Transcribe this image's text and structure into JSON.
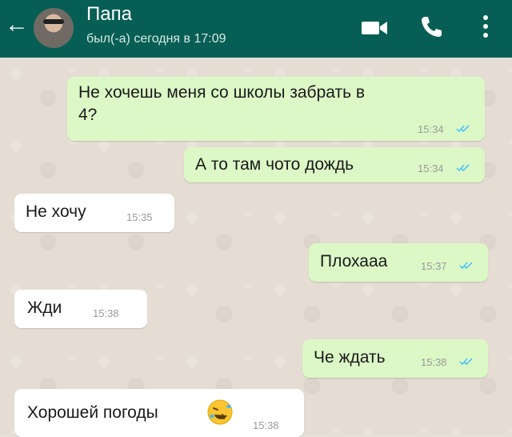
{
  "header": {
    "contact_name": "Папа",
    "last_seen": "был(-а) сегодня в 17:09",
    "back_icon": "←",
    "icons": [
      "back-arrow-icon",
      "avatar",
      "video-call-icon",
      "voice-call-icon",
      "more-menu-icon"
    ],
    "colors": {
      "bar": "#075e54",
      "outgoing_bubble": "#dcf8c6",
      "incoming_bubble": "#ffffff",
      "read_ticks": "#4fc3f7"
    }
  },
  "messages": [
    {
      "direction": "out",
      "text_line1": "Не хочешь меня со школы забрать в",
      "text_line2": "4?",
      "time": "15:34",
      "status": "read"
    },
    {
      "direction": "out",
      "text": "А то там чото дождь",
      "time": "15:34",
      "status": "read"
    },
    {
      "direction": "in",
      "text": "Не хочу",
      "time": "15:35"
    },
    {
      "direction": "out",
      "text": "Плохааа",
      "time": "15:37",
      "status": "read"
    },
    {
      "direction": "in",
      "text": "Жди",
      "time": "15:38"
    },
    {
      "direction": "out",
      "text": "Че ждать",
      "time": "15:38",
      "status": "read"
    },
    {
      "direction": "in",
      "text": "Хорошей погоды",
      "emoji": "rolling-on-floor-laughing-icon",
      "time": "15:38"
    }
  ]
}
